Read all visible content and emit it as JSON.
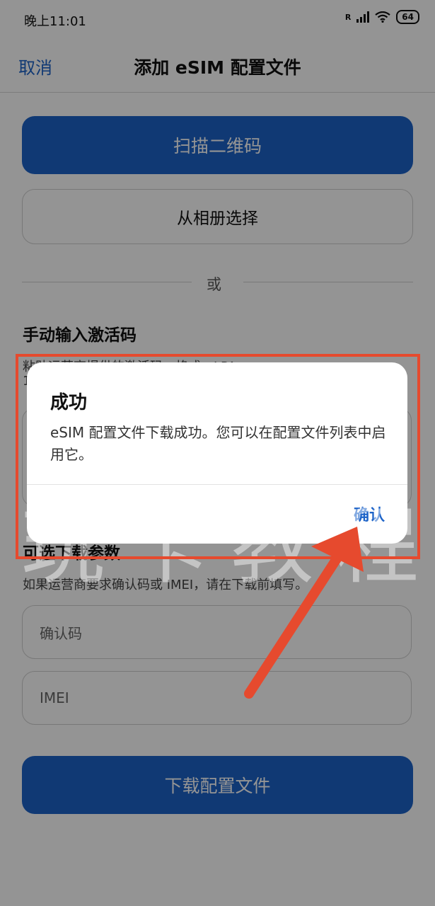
{
  "status": {
    "time": "晚上11:01",
    "roaming": "R",
    "battery": "64"
  },
  "header": {
    "cancel": "取消",
    "title": "添加 eSIM 配置文件"
  },
  "actions": {
    "scan": "扫描二维码",
    "album": "从相册选择",
    "or": "或"
  },
  "manual": {
    "title": "手动输入激活码",
    "hint": "粘贴运营商提供的激活码，格式：LPA:",
    "hint_line2": "1"
  },
  "optional": {
    "title": "可选下载参数",
    "hint": "如果运营商要求确认码或 IMEI，请在下载前填写。",
    "confirm_placeholder": "确认码",
    "imei_placeholder": "IMEI"
  },
  "download": {
    "label": "下载配置文件"
  },
  "dialog": {
    "title": "成功",
    "message": "eSIM 配置文件下载成功。您可以在配置文件列表中启用它。",
    "confirm": "确认"
  },
  "watermark": "玩卡教程",
  "colors": {
    "accent": "#1d63c8",
    "annotation": "#e64a2e"
  }
}
